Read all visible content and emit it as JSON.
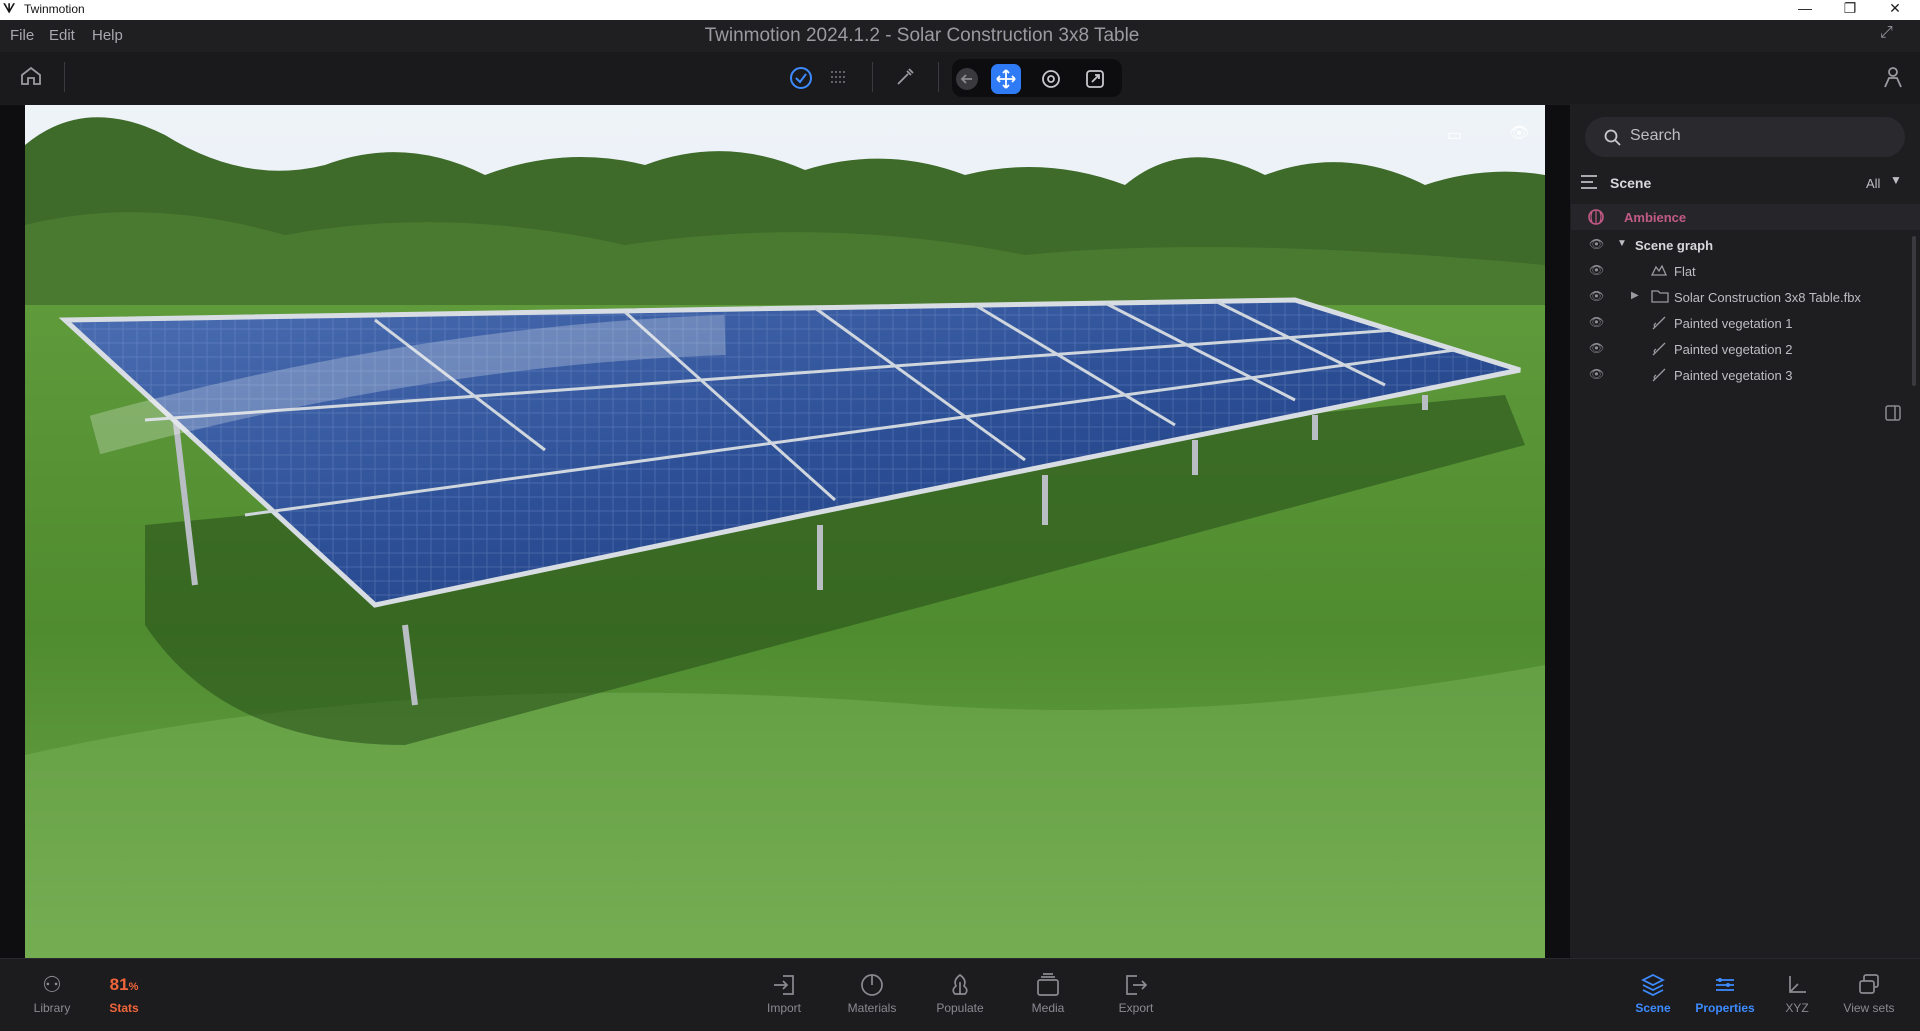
{
  "os": {
    "app_name": "Twinmotion",
    "minimize": "—",
    "maximize": "❐",
    "close": "✕"
  },
  "menu": {
    "file": "File",
    "edit": "Edit",
    "help": "Help"
  },
  "window_title": "Twinmotion 2024.1.2 - Solar Construction 3x8 Table",
  "panel": {
    "search_placeholder": "Search",
    "scene_label": "Scene",
    "filter_label": "All",
    "ambience_label": "Ambience",
    "tree": [
      {
        "label": "Scene graph",
        "icon": "caret-down-icon"
      },
      {
        "label": "Flat",
        "icon": "terrain-icon"
      },
      {
        "label": "Solar Construction 3x8 Table.fbx",
        "icon": "folder-icon"
      },
      {
        "label": "Painted vegetation 1",
        "icon": "brush-icon"
      },
      {
        "label": "Painted vegetation 2",
        "icon": "brush-icon"
      },
      {
        "label": "Painted vegetation 3",
        "icon": "brush-icon"
      }
    ]
  },
  "bottom": {
    "library": "Library",
    "stats_value": "81",
    "stats_unit": "%",
    "stats_label": "Stats",
    "import": "Import",
    "materials": "Materials",
    "populate": "Populate",
    "media": "Media",
    "export": "Export",
    "scene": "Scene",
    "properties": "Properties",
    "xyz": "XYZ",
    "view_sets": "View sets"
  },
  "colors": {
    "accent_blue": "#2f7bf5",
    "stats_orange": "#f0653a",
    "ambience_pink": "#c25a86"
  }
}
